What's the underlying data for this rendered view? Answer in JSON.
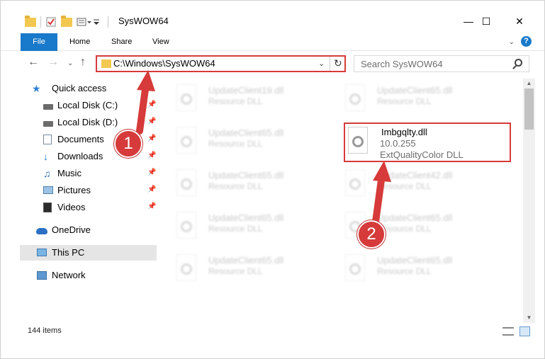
{
  "window": {
    "title": "SysWOW64",
    "controls": {
      "minimize": "—",
      "maximize": "☐",
      "close": "✕"
    }
  },
  "ribbon": {
    "tabs": [
      "File",
      "Home",
      "Share",
      "View"
    ],
    "help": "?"
  },
  "address": {
    "path": "C:\\Windows\\SysWOW64",
    "search_placeholder": "Search SysWOW64"
  },
  "sidebar": {
    "items": [
      {
        "label": "Quick access",
        "icon": "star-icon"
      },
      {
        "label": "Local Disk (C:)",
        "icon": "drive-icon",
        "pinned": true
      },
      {
        "label": "Local Disk (D:)",
        "icon": "drive-icon",
        "pinned": true
      },
      {
        "label": "Documents",
        "icon": "documents-icon",
        "pinned": true
      },
      {
        "label": "Downloads",
        "icon": "download-icon",
        "pinned": true
      },
      {
        "label": "Music",
        "icon": "music-icon",
        "pinned": true
      },
      {
        "label": "Pictures",
        "icon": "pictures-icon",
        "pinned": true
      },
      {
        "label": "Videos",
        "icon": "videos-icon",
        "pinned": true
      },
      {
        "label": "OneDrive",
        "icon": "onedrive-icon"
      },
      {
        "label": "This PC",
        "icon": "pc-icon",
        "selected": true
      },
      {
        "label": "Network",
        "icon": "network-icon"
      }
    ]
  },
  "files": [
    {
      "name": "UpdateClient19.dll",
      "desc": "Resource DLL"
    },
    {
      "name": "UpdateClient65.dll",
      "desc": "Resource DLL"
    },
    {
      "name": "UpdateClient65.dll",
      "desc": "Resource DLL"
    },
    {
      "name": "Imbgqlty.dll",
      "version": "10.0.255",
      "desc": "ExtQualityColor DLL",
      "highlighted": true
    },
    {
      "name": "UpdateClient65.dll",
      "desc": "Resource DLL"
    },
    {
      "name": "UpdateClient42.dll",
      "desc": "Resource DLL"
    },
    {
      "name": "UpdateClient65.dll",
      "desc": "Resource DLL"
    },
    {
      "name": "UpdateClient65.dll",
      "desc": "Resource DLL"
    },
    {
      "name": "UpdateClient65.dll",
      "desc": "Resource DLL"
    },
    {
      "name": "UpdateClient65.dll",
      "desc": "Resource DLL"
    }
  ],
  "status": {
    "item_count": "144 items"
  },
  "annotations": [
    {
      "number": "1"
    },
    {
      "number": "2"
    }
  ],
  "colors": {
    "accent": "#1979ca",
    "annotation": "#d63a3a"
  }
}
